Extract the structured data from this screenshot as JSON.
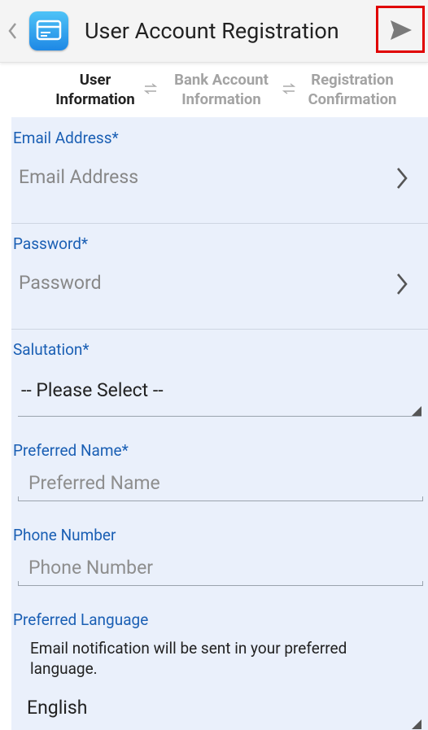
{
  "app": {
    "title": "User Account Registration",
    "icon": "app-card-icon",
    "send_icon": "send-icon",
    "back_icon": "chevron-left-icon"
  },
  "steps": [
    {
      "line1": "User",
      "line2": "Information",
      "state": "active"
    },
    {
      "line1": "Bank Account",
      "line2": "Information",
      "state": "inactive"
    },
    {
      "line1": "Registration",
      "line2": "Confirmation",
      "state": "inactive"
    }
  ],
  "form": {
    "email": {
      "label": "Email Address*",
      "placeholder": "Email Address"
    },
    "password": {
      "label": "Password*",
      "placeholder": "Password"
    },
    "salutation": {
      "label": "Salutation*",
      "selected": "-- Please Select --"
    },
    "preferred_name": {
      "label": "Preferred Name*",
      "placeholder": "Preferred Name"
    },
    "phone": {
      "label": "Phone Number",
      "placeholder": "Phone Number"
    },
    "language": {
      "label": "Preferred Language",
      "note": "Email notification will be sent in your preferred language.",
      "selected": "English"
    }
  },
  "colors": {
    "label_blue": "#1a5fb4",
    "panel_bg": "#eaf0fb",
    "highlight_red": "#e00000"
  }
}
